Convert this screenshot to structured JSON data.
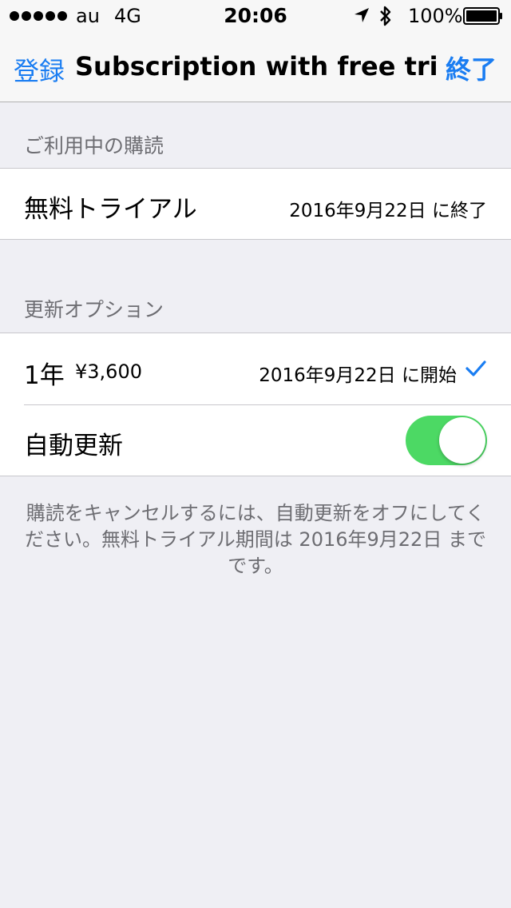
{
  "status_bar": {
    "carrier": "au",
    "network": "4G",
    "time": "20:06",
    "battery_percent": "100%",
    "icons": [
      "signal-dots-icon",
      "location-arrow-icon",
      "bluetooth-icon",
      "battery-icon"
    ]
  },
  "nav": {
    "back_label": "登録",
    "title": "Subscription with free trial...",
    "done_label": "終了"
  },
  "current_subscription": {
    "header": "ご利用中の購読",
    "plan_label": "無料トライアル",
    "end_text": "2016年9月22日 に終了"
  },
  "renewal_options": {
    "header": "更新オプション",
    "period_label": "1年",
    "price": "¥3,600",
    "start_text": "2016年9月22日 に開始",
    "selected": true,
    "auto_renew_label": "自動更新",
    "auto_renew_on": true
  },
  "footer": {
    "note": "購読をキャンセルするには、自動更新をオフにしてください。無料トライアル期間は 2016年9月22日 までです。"
  },
  "colors": {
    "accent": "#1a7df2",
    "toggle_on": "#4cd964",
    "background": "#efeff4",
    "secondary_text": "#6d6d72"
  }
}
